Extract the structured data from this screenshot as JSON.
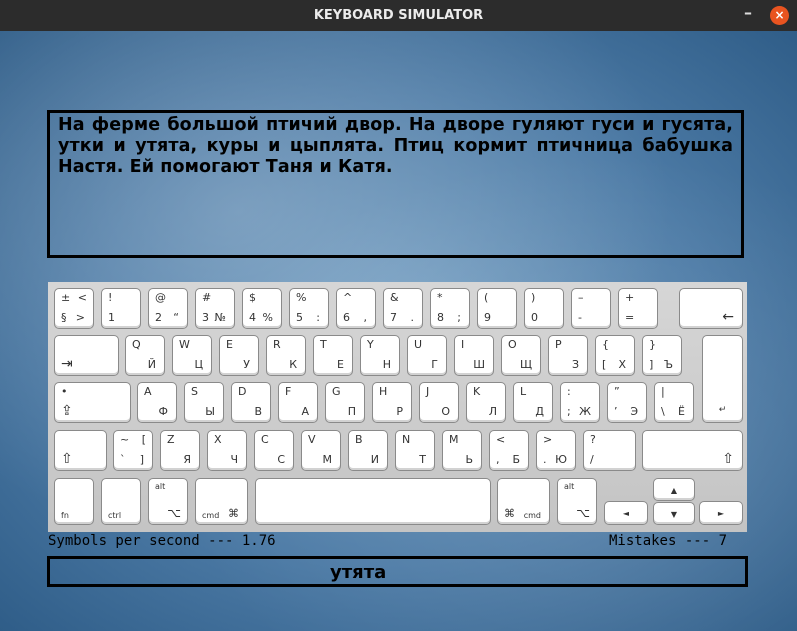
{
  "window": {
    "title": "KEYBOARD SIMULATOR",
    "minimize_symbol": "–",
    "close_symbol": "×"
  },
  "text_area": {
    "text": "На ферме большой птичий двор. На дворе гуляют гуси и гусята, утки и утята, куры и цыплята. Птиц кормит птичница бабушка Настя. Ей помогают Таня и Катя."
  },
  "stats": {
    "speed_label": "Symbols per second --- ",
    "speed_value": "1.76",
    "mistakes_label": "Mistakes --- ",
    "mistakes_value": "7"
  },
  "input": {
    "current_word": "утята"
  },
  "keyboard": {
    "rows": [
      [
        {
          "name": "key-tilde",
          "tl": "±",
          "bl": "§",
          "tr": "<",
          "br": ">"
        },
        {
          "name": "key-1",
          "tl": "!",
          "bl": "1"
        },
        {
          "name": "key-2",
          "tl": "@",
          "bl": "2",
          "br": "“"
        },
        {
          "name": "key-3",
          "tl": "#",
          "bl": "3",
          "br": "№"
        },
        {
          "name": "key-4",
          "tl": "$",
          "bl": "4",
          "br": "%"
        },
        {
          "name": "key-5",
          "tl": "%",
          "bl": "5",
          "br": ":"
        },
        {
          "name": "key-6",
          "tl": "^",
          "bl": "6",
          "br": ","
        },
        {
          "name": "key-7",
          "tl": "&",
          "bl": "7",
          "br": "."
        },
        {
          "name": "key-8",
          "tl": "*",
          "bl": "8",
          "br": ";"
        },
        {
          "name": "key-9",
          "tl": "(",
          "bl": "9"
        },
        {
          "name": "key-0",
          "tl": ")",
          "bl": "0"
        },
        {
          "name": "key-minus",
          "tl": "–",
          "bl": "-"
        },
        {
          "name": "key-equals",
          "tl": "+",
          "bl": "="
        },
        {
          "name": "key-backspace",
          "icon": "←"
        }
      ],
      [
        {
          "name": "key-tab",
          "icon": "⇥"
        },
        {
          "name": "key-q",
          "tl": "Q",
          "br": "Й"
        },
        {
          "name": "key-w",
          "tl": "W",
          "br": "Ц"
        },
        {
          "name": "key-e",
          "tl": "E",
          "br": "У"
        },
        {
          "name": "key-r",
          "tl": "R",
          "br": "К"
        },
        {
          "name": "key-t",
          "tl": "T",
          "br": "Е"
        },
        {
          "name": "key-y",
          "tl": "Y",
          "br": "Н"
        },
        {
          "name": "key-u",
          "tl": "U",
          "br": "Г"
        },
        {
          "name": "key-i",
          "tl": "I",
          "br": "Ш"
        },
        {
          "name": "key-o",
          "tl": "O",
          "br": "Щ"
        },
        {
          "name": "key-p",
          "tl": "P",
          "br": "З"
        },
        {
          "name": "key-lbracket",
          "tl": "{",
          "bl": "[",
          "br": "Х"
        },
        {
          "name": "key-rbracket",
          "tl": "}",
          "bl": "]",
          "br": "Ъ"
        },
        {
          "name": "key-enter",
          "icon": "↵"
        }
      ],
      [
        {
          "name": "key-capslock",
          "tl": "•",
          "icon": "⇪"
        },
        {
          "name": "key-a",
          "tl": "A",
          "br": "Ф"
        },
        {
          "name": "key-s",
          "tl": "S",
          "br": "Ы"
        },
        {
          "name": "key-d",
          "tl": "D",
          "br": "В"
        },
        {
          "name": "key-f",
          "tl": "F",
          "br": "А"
        },
        {
          "name": "key-g",
          "tl": "G",
          "br": "П"
        },
        {
          "name": "key-h",
          "tl": "H",
          "br": "Р"
        },
        {
          "name": "key-j",
          "tl": "J",
          "br": "О"
        },
        {
          "name": "key-k",
          "tl": "K",
          "br": "Л"
        },
        {
          "name": "key-l",
          "tl": "L",
          "br": "Д"
        },
        {
          "name": "key-semicolon",
          "tl": ":",
          "bl": ";",
          "br": "Ж"
        },
        {
          "name": "key-quote",
          "tl": "”",
          "bl": "’",
          "br": "Э"
        },
        {
          "name": "key-backslash",
          "tl": "|",
          "bl": "\\",
          "br": "Ё"
        }
      ],
      [
        {
          "name": "key-lshift",
          "icon": "⇧"
        },
        {
          "name": "key-grave",
          "tl": "~",
          "bl": "`",
          "tr": "[",
          "br": "]"
        },
        {
          "name": "key-z",
          "tl": "Z",
          "br": "Я"
        },
        {
          "name": "key-x",
          "tl": "X",
          "br": "Ч"
        },
        {
          "name": "key-c",
          "tl": "C",
          "br": "С"
        },
        {
          "name": "key-v",
          "tl": "V",
          "br": "М"
        },
        {
          "name": "key-b",
          "tl": "B",
          "br": "И"
        },
        {
          "name": "key-n",
          "tl": "N",
          "br": "Т"
        },
        {
          "name": "key-m",
          "tl": "M",
          "br": "Ь"
        },
        {
          "name": "key-comma",
          "tl": "<",
          "bl": ",",
          "br": "Б"
        },
        {
          "name": "key-period",
          "tl": ">",
          "bl": ".",
          "br": "Ю"
        },
        {
          "name": "key-slash",
          "tl": "?",
          "bl": "/"
        },
        {
          "name": "key-rshift",
          "icon": "⇧"
        }
      ],
      [
        {
          "name": "key-fn",
          "bl": "fn"
        },
        {
          "name": "key-ctrl",
          "bl": "ctrl"
        },
        {
          "name": "key-lalt",
          "tl": "alt",
          "icon": "⌥"
        },
        {
          "name": "key-lcmd",
          "bl": "cmd",
          "br": "⌘"
        },
        {
          "name": "key-space"
        },
        {
          "name": "key-rcmd",
          "bl": "⌘",
          "br": "cmd"
        },
        {
          "name": "key-ralt",
          "tl": "alt",
          "icon": "⌥"
        },
        {
          "name": "key-left",
          "icon": "◄"
        },
        {
          "name": "key-up",
          "icon": "▲"
        },
        {
          "name": "key-down",
          "icon": "▼"
        },
        {
          "name": "key-right",
          "icon": "►"
        }
      ]
    ]
  }
}
